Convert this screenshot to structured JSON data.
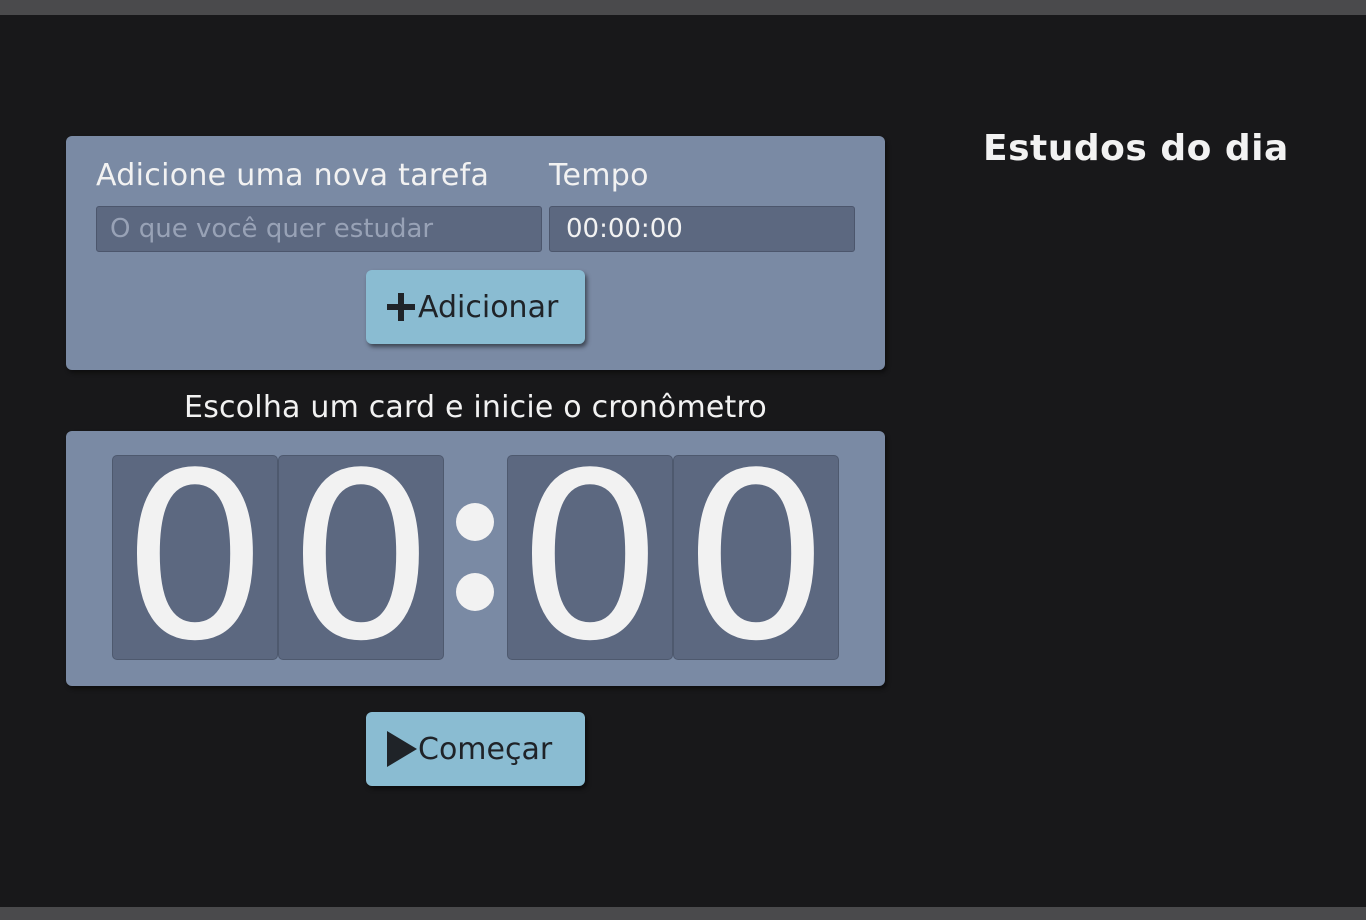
{
  "form": {
    "task_label": "Adicione uma nova tarefa",
    "time_label": "Tempo",
    "task_placeholder": "O que você quer estudar",
    "time_value": "00:00:00",
    "add_button_label": "Adicionar",
    "add_icon": "plus-icon"
  },
  "timer": {
    "caption": "Escolha um card e inicie o cronômetro",
    "digits": [
      "0",
      "0",
      "0",
      "0"
    ],
    "start_button_label": "Começar",
    "start_icon": "play-icon"
  },
  "sidebar": {
    "title": "Estudos do dia"
  },
  "colors": {
    "background": "#18181a",
    "card": "#7a8aa4",
    "field": "#5c6880",
    "button": "#8abcd2",
    "text": "#f2f2f2"
  }
}
